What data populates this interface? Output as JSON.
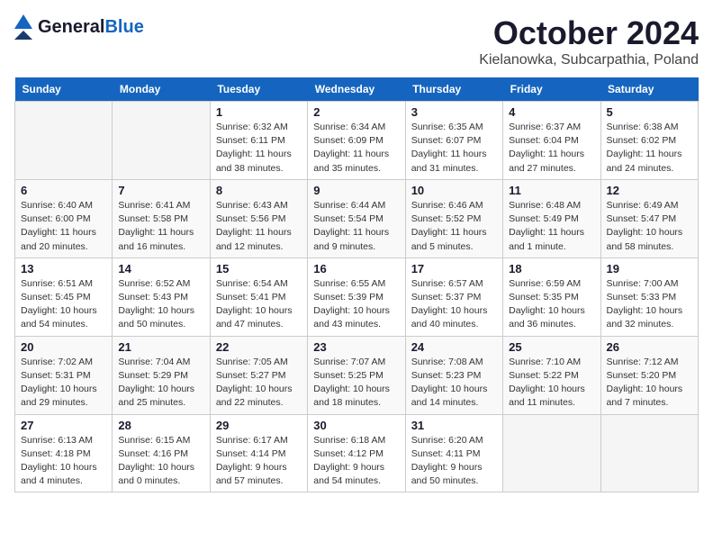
{
  "header": {
    "logo_general": "General",
    "logo_blue": "Blue",
    "month": "October 2024",
    "location": "Kielanowka, Subcarpathia, Poland"
  },
  "days_of_week": [
    "Sunday",
    "Monday",
    "Tuesday",
    "Wednesday",
    "Thursday",
    "Friday",
    "Saturday"
  ],
  "weeks": [
    [
      {
        "day": "",
        "info": ""
      },
      {
        "day": "",
        "info": ""
      },
      {
        "day": "1",
        "info": "Sunrise: 6:32 AM\nSunset: 6:11 PM\nDaylight: 11 hours and 38 minutes."
      },
      {
        "day": "2",
        "info": "Sunrise: 6:34 AM\nSunset: 6:09 PM\nDaylight: 11 hours and 35 minutes."
      },
      {
        "day": "3",
        "info": "Sunrise: 6:35 AM\nSunset: 6:07 PM\nDaylight: 11 hours and 31 minutes."
      },
      {
        "day": "4",
        "info": "Sunrise: 6:37 AM\nSunset: 6:04 PM\nDaylight: 11 hours and 27 minutes."
      },
      {
        "day": "5",
        "info": "Sunrise: 6:38 AM\nSunset: 6:02 PM\nDaylight: 11 hours and 24 minutes."
      }
    ],
    [
      {
        "day": "6",
        "info": "Sunrise: 6:40 AM\nSunset: 6:00 PM\nDaylight: 11 hours and 20 minutes."
      },
      {
        "day": "7",
        "info": "Sunrise: 6:41 AM\nSunset: 5:58 PM\nDaylight: 11 hours and 16 minutes."
      },
      {
        "day": "8",
        "info": "Sunrise: 6:43 AM\nSunset: 5:56 PM\nDaylight: 11 hours and 12 minutes."
      },
      {
        "day": "9",
        "info": "Sunrise: 6:44 AM\nSunset: 5:54 PM\nDaylight: 11 hours and 9 minutes."
      },
      {
        "day": "10",
        "info": "Sunrise: 6:46 AM\nSunset: 5:52 PM\nDaylight: 11 hours and 5 minutes."
      },
      {
        "day": "11",
        "info": "Sunrise: 6:48 AM\nSunset: 5:49 PM\nDaylight: 11 hours and 1 minute."
      },
      {
        "day": "12",
        "info": "Sunrise: 6:49 AM\nSunset: 5:47 PM\nDaylight: 10 hours and 58 minutes."
      }
    ],
    [
      {
        "day": "13",
        "info": "Sunrise: 6:51 AM\nSunset: 5:45 PM\nDaylight: 10 hours and 54 minutes."
      },
      {
        "day": "14",
        "info": "Sunrise: 6:52 AM\nSunset: 5:43 PM\nDaylight: 10 hours and 50 minutes."
      },
      {
        "day": "15",
        "info": "Sunrise: 6:54 AM\nSunset: 5:41 PM\nDaylight: 10 hours and 47 minutes."
      },
      {
        "day": "16",
        "info": "Sunrise: 6:55 AM\nSunset: 5:39 PM\nDaylight: 10 hours and 43 minutes."
      },
      {
        "day": "17",
        "info": "Sunrise: 6:57 AM\nSunset: 5:37 PM\nDaylight: 10 hours and 40 minutes."
      },
      {
        "day": "18",
        "info": "Sunrise: 6:59 AM\nSunset: 5:35 PM\nDaylight: 10 hours and 36 minutes."
      },
      {
        "day": "19",
        "info": "Sunrise: 7:00 AM\nSunset: 5:33 PM\nDaylight: 10 hours and 32 minutes."
      }
    ],
    [
      {
        "day": "20",
        "info": "Sunrise: 7:02 AM\nSunset: 5:31 PM\nDaylight: 10 hours and 29 minutes."
      },
      {
        "day": "21",
        "info": "Sunrise: 7:04 AM\nSunset: 5:29 PM\nDaylight: 10 hours and 25 minutes."
      },
      {
        "day": "22",
        "info": "Sunrise: 7:05 AM\nSunset: 5:27 PM\nDaylight: 10 hours and 22 minutes."
      },
      {
        "day": "23",
        "info": "Sunrise: 7:07 AM\nSunset: 5:25 PM\nDaylight: 10 hours and 18 minutes."
      },
      {
        "day": "24",
        "info": "Sunrise: 7:08 AM\nSunset: 5:23 PM\nDaylight: 10 hours and 14 minutes."
      },
      {
        "day": "25",
        "info": "Sunrise: 7:10 AM\nSunset: 5:22 PM\nDaylight: 10 hours and 11 minutes."
      },
      {
        "day": "26",
        "info": "Sunrise: 7:12 AM\nSunset: 5:20 PM\nDaylight: 10 hours and 7 minutes."
      }
    ],
    [
      {
        "day": "27",
        "info": "Sunrise: 6:13 AM\nSunset: 4:18 PM\nDaylight: 10 hours and 4 minutes."
      },
      {
        "day": "28",
        "info": "Sunrise: 6:15 AM\nSunset: 4:16 PM\nDaylight: 10 hours and 0 minutes."
      },
      {
        "day": "29",
        "info": "Sunrise: 6:17 AM\nSunset: 4:14 PM\nDaylight: 9 hours and 57 minutes."
      },
      {
        "day": "30",
        "info": "Sunrise: 6:18 AM\nSunset: 4:12 PM\nDaylight: 9 hours and 54 minutes."
      },
      {
        "day": "31",
        "info": "Sunrise: 6:20 AM\nSunset: 4:11 PM\nDaylight: 9 hours and 50 minutes."
      },
      {
        "day": "",
        "info": ""
      },
      {
        "day": "",
        "info": ""
      }
    ]
  ]
}
